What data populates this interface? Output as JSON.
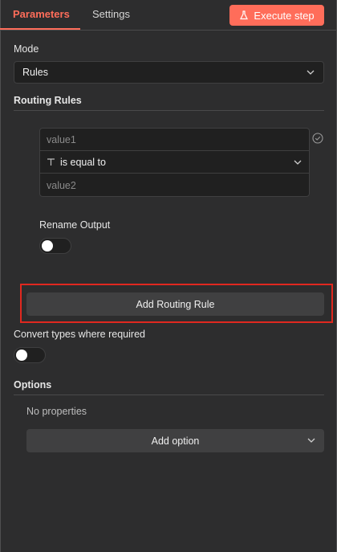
{
  "tabs": [
    {
      "label": "Parameters",
      "active": true
    },
    {
      "label": "Settings",
      "active": false
    }
  ],
  "execute_button": {
    "label": "Execute step",
    "icon": "flask-icon",
    "color": "#ff6d5a"
  },
  "mode": {
    "label": "Mode",
    "value": "Rules"
  },
  "routing_rules": {
    "title": "Routing Rules",
    "rule": {
      "value1_placeholder": "value1",
      "operator": "is equal to",
      "operator_type_icon": "text-type-icon",
      "value2_placeholder": "value2"
    },
    "rename_output": {
      "label": "Rename Output",
      "enabled": false
    },
    "add_button": "Add Routing Rule"
  },
  "convert_types": {
    "label": "Convert types where required",
    "enabled": false
  },
  "options": {
    "title": "Options",
    "empty_text": "No properties",
    "add_button": "Add option"
  },
  "colors": {
    "accent": "#ff6d5a",
    "highlight": "#e0281f",
    "background": "#2d2d2e"
  }
}
